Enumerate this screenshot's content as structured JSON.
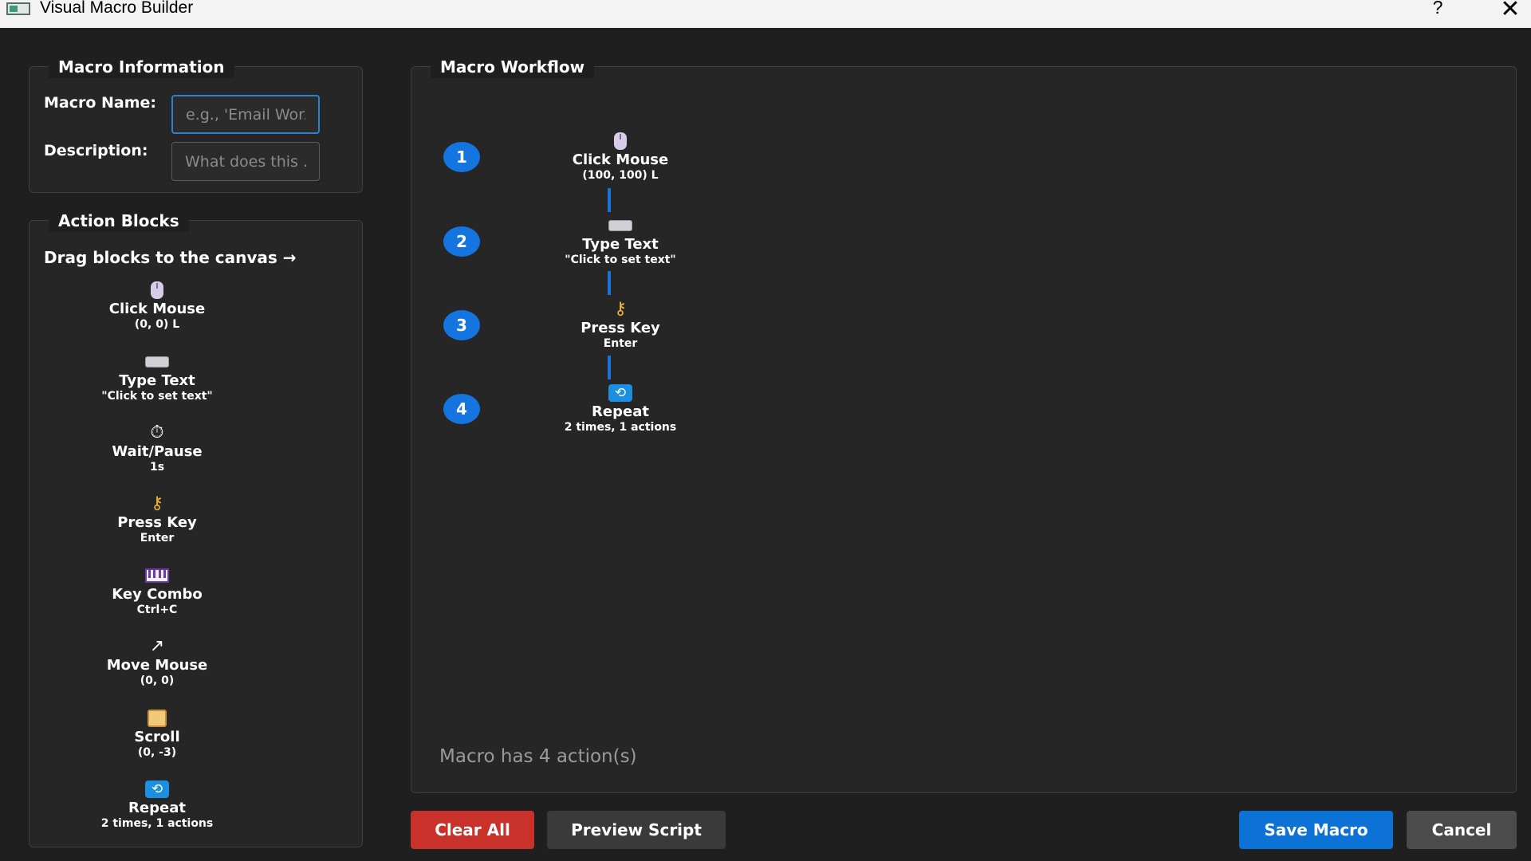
{
  "window": {
    "title": "Visual Macro Builder",
    "help_label": "?",
    "close_label": "✕"
  },
  "macro_info": {
    "group_title": "Macro Information",
    "name_label": "Macro Name:",
    "name_placeholder": "e.g., 'Email Wor...",
    "name_value": "",
    "description_label": "Description:",
    "description_placeholder": "What does this ...",
    "description_value": ""
  },
  "action_blocks": {
    "group_title": "Action Blocks",
    "hint": "Drag blocks to the canvas →",
    "items": [
      {
        "icon": "mouse-icon",
        "title": "Click Mouse",
        "subtitle": "(0, 0) L"
      },
      {
        "icon": "keyboard-icon",
        "title": "Type Text",
        "subtitle": "\"Click to set text\""
      },
      {
        "icon": "stopwatch-icon",
        "title": "Wait/Pause",
        "subtitle": "1s"
      },
      {
        "icon": "key-icon",
        "title": "Press Key",
        "subtitle": "Enter"
      },
      {
        "icon": "piano-keys-icon",
        "title": "Key Combo",
        "subtitle": "Ctrl+C"
      },
      {
        "icon": "arrow-up-right-icon",
        "title": "Move Mouse",
        "subtitle": "(0, 0)"
      },
      {
        "icon": "scroll-icon",
        "title": "Scroll",
        "subtitle": "(0, -3)"
      },
      {
        "icon": "repeat-icon",
        "title": "Repeat",
        "subtitle": "2 times, 1 actions"
      }
    ]
  },
  "workflow": {
    "group_title": "Macro Workflow",
    "steps": [
      {
        "number": "1",
        "icon": "mouse-icon",
        "title": "Click Mouse",
        "subtitle": "(100, 100) L"
      },
      {
        "number": "2",
        "icon": "keyboard-icon",
        "title": "Type Text",
        "subtitle": "\"Click to set text\""
      },
      {
        "number": "3",
        "icon": "key-icon",
        "title": "Press Key",
        "subtitle": "Enter"
      },
      {
        "number": "4",
        "icon": "repeat-icon",
        "title": "Repeat",
        "subtitle": "2 times, 1 actions"
      }
    ],
    "status": "Macro has 4 action(s)"
  },
  "buttons": {
    "clear_all": "Clear All",
    "preview_script": "Preview Script",
    "save_macro": "Save Macro",
    "cancel": "Cancel"
  },
  "colors": {
    "accent": "#1474e0",
    "danger": "#c9322b",
    "background": "#1f1f1f",
    "panel": "#262626"
  }
}
